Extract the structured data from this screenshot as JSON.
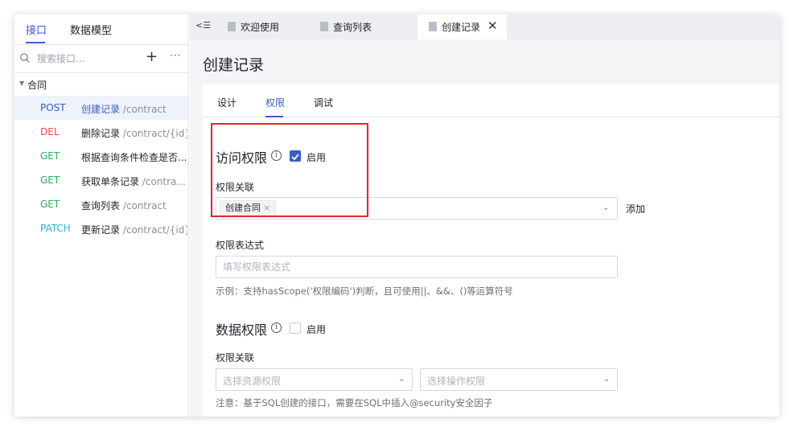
{
  "sidebar": {
    "tabs": [
      {
        "label": "接口",
        "active": true
      },
      {
        "label": "数据模型",
        "active": false
      }
    ],
    "search_placeholder": "搜索接口...",
    "group": {
      "name": "合同",
      "expanded": true
    },
    "apis": [
      {
        "method": "POST",
        "method_color": "#3a5ccc",
        "name": "创建记录",
        "path": "/contract",
        "active": true
      },
      {
        "method": "DEL",
        "method_color": "#e5484d",
        "name": "删除记录",
        "path": "/contract/{id}",
        "active": false
      },
      {
        "method": "GET",
        "method_color": "#2faa5b",
        "name": "根据查询条件检查是否...",
        "path": "",
        "active": false
      },
      {
        "method": "GET",
        "method_color": "#2faa5b",
        "name": "获取单条记录",
        "path": "/contra...",
        "active": false
      },
      {
        "method": "GET",
        "method_color": "#2faa5b",
        "name": "查询列表",
        "path": "/contract",
        "active": false
      },
      {
        "method": "PATCH",
        "method_color": "#27b3c9",
        "name": "更新记录",
        "path": "/contract/{id}",
        "active": false
      }
    ]
  },
  "tabs": [
    {
      "label": "欢迎使用",
      "active": false
    },
    {
      "label": "查询列表",
      "active": false
    },
    {
      "label": "创建记录",
      "active": true
    }
  ],
  "page_title": "创建记录",
  "subtabs": [
    {
      "label": "设计",
      "active": false
    },
    {
      "label": "权限",
      "active": true
    },
    {
      "label": "调试",
      "active": false
    }
  ],
  "access": {
    "title": "访问权限",
    "enabled": true,
    "enable_label": "启用",
    "relation_label": "权限关联",
    "tag": "创建合同",
    "add_label": "添加",
    "expression_label": "权限表达式",
    "expression_placeholder": "填写权限表达式",
    "example": "示例：支持hasScope('权限编码')判断，且可使用||、&&、()等运算符号"
  },
  "data_perm": {
    "title": "数据权限",
    "enabled": false,
    "enable_label": "启用",
    "relation_label": "权限关联",
    "resource_placeholder": "选择资源权限",
    "operation_placeholder": "选择操作权限",
    "note": "注意：基于SQL创建的接口，需要在SQL中插入@security安全因子"
  },
  "colors": {
    "accent": "#3a5ccc",
    "highlight": "#e0252b"
  }
}
